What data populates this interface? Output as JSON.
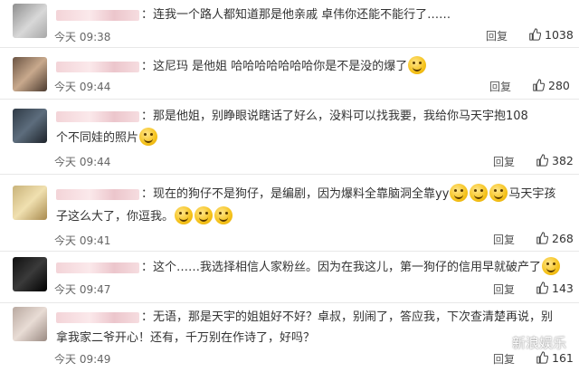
{
  "comments": [
    {
      "text": "连我一个路人都知道那是他亲戚 卓伟你还能不能行了……",
      "time": "今天 09:38",
      "reply": "回复",
      "likes": "1038"
    },
    {
      "text": "这尼玛 是他姐 哈哈哈哈哈哈哈你是不是没的爆了",
      "time": "今天 09:44",
      "reply": "回复",
      "likes": "280"
    },
    {
      "text1": "那是他姐，别睁眼说瞎话了好么，没料可以找我要，我给你马天宇抱108",
      "text2": "个不同娃的照片",
      "time": "今天 09:44",
      "reply": "回复",
      "likes": "382"
    },
    {
      "text1a": "现在的狗仔不是狗仔，是编剧，因为爆料全靠脑洞全靠yy",
      "text1b": "马天宇孩",
      "text2": "子这么大了，你逗我。",
      "time": "今天 09:41",
      "reply": "回复",
      "likes": "268"
    },
    {
      "text": "这个……我选择相信人家粉丝。因为在我这儿，第一狗仔的信用早就破产了",
      "time": "今天 09:47",
      "reply": "回复",
      "likes": "143"
    },
    {
      "text1": "无语，那是天宇的姐姐好不好？卓叔，别闹了，答应我，下次查清楚再说，别",
      "text2": "拿我家二爷开心！还有，千万别在作诗了，好吗？",
      "time": "今天 09:49",
      "reply": "回复",
      "likes": "161"
    }
  ],
  "watermark": "新浪娱乐"
}
